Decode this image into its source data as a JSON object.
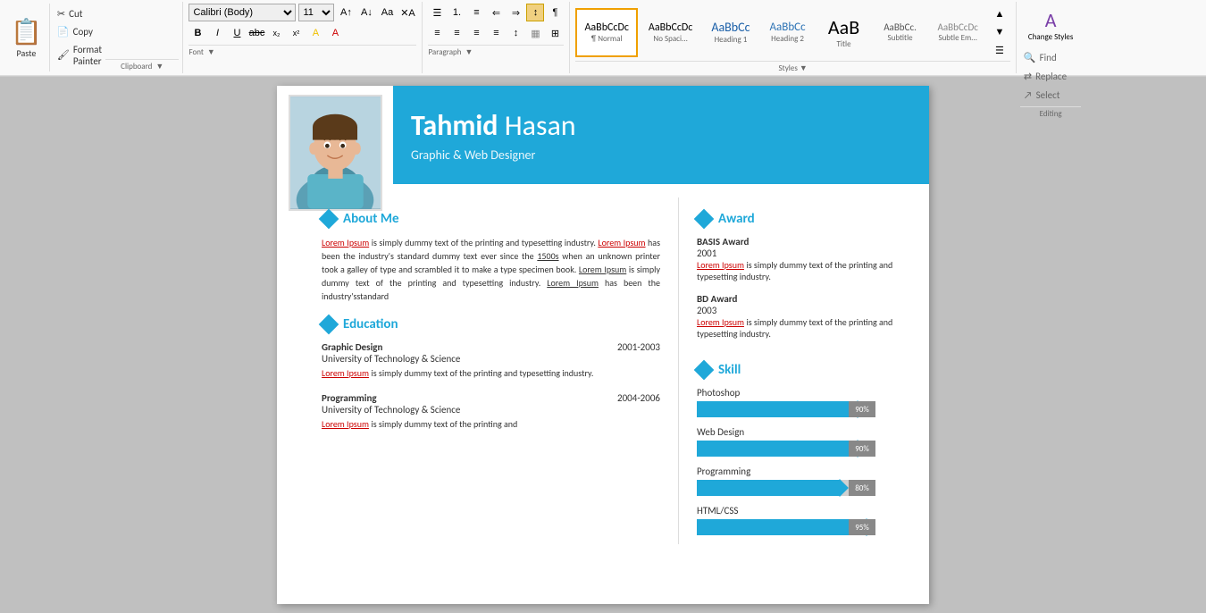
{
  "toolbar": {
    "paste_label": "Paste",
    "cut_label": "Cut",
    "copy_label": "Copy",
    "format_painter_label": "Format Painter",
    "clipboard_label": "Clipboard",
    "font_name": "Calibri (Body)",
    "font_size": "11",
    "font_label": "Font",
    "paragraph_label": "Paragraph",
    "styles_label": "Styles",
    "editing_label": "Editing",
    "find_label": "Find",
    "replace_label": "Replace",
    "select_label": "Select",
    "change_styles_label": "Change Styles",
    "styles": [
      {
        "label": "Normal",
        "preview": "AaBbCcDc",
        "active": true
      },
      {
        "label": "No Spaci...",
        "preview": "AaBbCcDc",
        "active": false
      },
      {
        "label": "Heading 1",
        "preview": "AaBbCc",
        "active": false
      },
      {
        "label": "Heading 2",
        "preview": "AaBbCc",
        "active": false
      },
      {
        "label": "Title",
        "preview": "AaB",
        "active": false
      },
      {
        "label": "Subtitle",
        "preview": "AaBbCc.",
        "active": false
      },
      {
        "label": "Subtle Em...",
        "preview": "AaBbCcDc",
        "active": false
      }
    ]
  },
  "resume": {
    "header": {
      "first_name": "Tahmid",
      "last_name": "Hasan",
      "title": "Graphic & Web Designer"
    },
    "about": {
      "section_title": "About Me",
      "text1": "Lorem Ipsum",
      "text2": " is simply dummy text of the printing and typesetting industry. ",
      "text3": "Lorem Ipsum",
      "text4": " has been the industry's standard dummy text ever since the ",
      "text5": "1500s",
      "text6": " when an unknown printer took a galley of type and scrambled it to make a type specimen book. ",
      "text7": "Lorem Ipsum",
      "text8": " is simply dummy text of the printing and typesetting industry. ",
      "text9": "Lorem Ipsum",
      "text10": " has been the industry'sstandard"
    },
    "education": {
      "section_title": "Education",
      "items": [
        {
          "degree": "Graphic Design",
          "years": "2001-2003",
          "school": "University of Technology & Science",
          "desc_red": "Lorem Ipsum",
          "desc_normal": " is simply dummy text of the printing and typesetting industry."
        },
        {
          "degree": "Programming",
          "years": "2004-2006",
          "school": "University of Technology & Science",
          "desc_red": "Lorem Ipsum",
          "desc_normal": " is simply dummy text of the printing and"
        }
      ]
    },
    "awards": {
      "section_title": "Award",
      "items": [
        {
          "title": "BASIS Award",
          "year": "2001",
          "desc_red": "Lorem Ipsum",
          "desc_normal": " is simply dummy text of the printing and typesetting industry."
        },
        {
          "title": "BD Award",
          "year": "2003",
          "desc_red": "Lorem Ipsum",
          "desc_normal": " is simply dummy text of the printing and typesetting industry."
        }
      ]
    },
    "skills": {
      "section_title": "Skill",
      "items": [
        {
          "name": "Photoshop",
          "percent": 90
        },
        {
          "name": "Web Design",
          "percent": 90
        },
        {
          "name": "Programming",
          "percent": 80
        },
        {
          "name": "HTML/CSS",
          "percent": 95
        }
      ]
    }
  }
}
